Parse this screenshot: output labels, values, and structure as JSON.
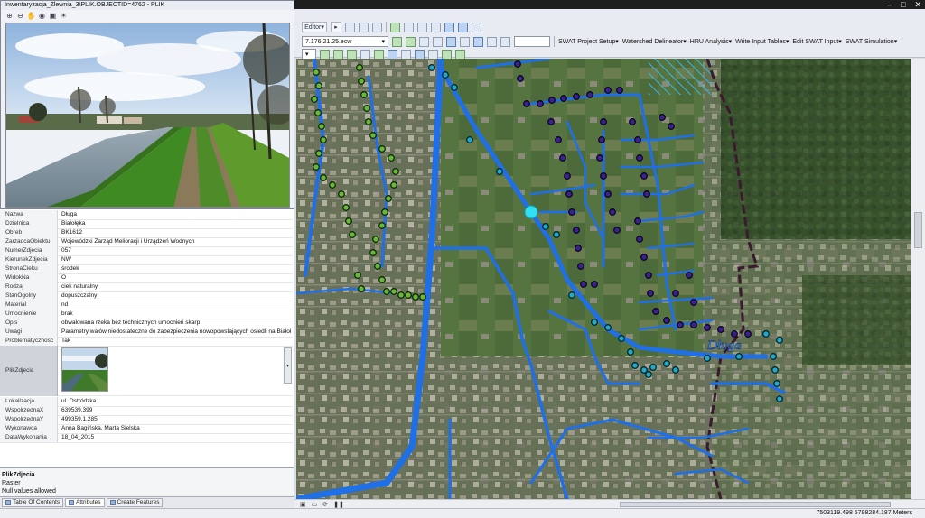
{
  "photo_window": {
    "title": "Inwentaryzacja_Zlewnia_3\\PLIK.OBJECTID=4762 - PLIK",
    "tools": [
      "zoom-in-icon",
      "zoom-out-icon",
      "pan-icon",
      "full-extent-icon",
      "open-icon",
      "light-icon"
    ]
  },
  "toolbar": {
    "editor_label": "Editor",
    "scale_combo": "7.176.21.25.ecw",
    "menus": [
      "SWAT Project Setup",
      "Watershed Delineator",
      "HRU Analysis",
      "Write Input Tables",
      "Edit SWAT Input",
      "SWAT Simulation"
    ]
  },
  "attributes": [
    {
      "key": "Nazwa",
      "value": "Długa"
    },
    {
      "key": "Dzielnica",
      "value": "Białołęka"
    },
    {
      "key": "Obreb",
      "value": "BK1612"
    },
    {
      "key": "ZarzadcaObiektu",
      "value": "Wojewódzki Zarząd Melioracji i Urządzeń Wodnych"
    },
    {
      "key": "NumerZdjecia",
      "value": "057"
    },
    {
      "key": "KierunekZdjecia",
      "value": "NW"
    },
    {
      "key": "StronaCieku",
      "value": "środek"
    },
    {
      "key": "WidokNa",
      "value": "O"
    },
    {
      "key": "Rodzaj",
      "value": "ciek naturalny"
    },
    {
      "key": "StanOgolny",
      "value": "dopuszczalny"
    },
    {
      "key": "Material",
      "value": "nd"
    },
    {
      "key": "Umocnienie",
      "value": "brak"
    },
    {
      "key": "Opis",
      "value": "obwałowana rzeka bez technicznych umocnień skarp"
    },
    {
      "key": "Uwagi",
      "value": "Parametry wałów niedostateczne do zabezpieczenia nowopowstających osiedli na Białołęce"
    },
    {
      "key": "Problematycznosc",
      "value": "Tak"
    }
  ],
  "photo_field": {
    "key": "PlikZdjecia"
  },
  "attributes_after": [
    {
      "key": "Lokalizacja",
      "value": "ul. Ostródzka"
    },
    {
      "key": "WspolrzednaX",
      "value": "639539.399"
    },
    {
      "key": "WspolrzednaY",
      "value": "499359.1.285"
    },
    {
      "key": "Wykonawca",
      "value": "Anna Bagińska, Marta Sielska"
    },
    {
      "key": "DataWykonania",
      "value": "18_04_2015"
    }
  ],
  "description": {
    "title": "PlikZdjecia",
    "line1": "Raster",
    "line2": "Null values allowed"
  },
  "tabs": [
    "Table Of Contents",
    "Attributes",
    "Create Features"
  ],
  "map": {
    "river_label": "Długa",
    "colors": {
      "river": "#1f6fe6",
      "point_green": "#6ab83a",
      "point_purple": "#3b2090",
      "point_cyan": "#22a8c8",
      "selected": "#33e0f0",
      "boundary": "#3a1a2e"
    }
  },
  "status": {
    "coordinates": "7503119.498  5798284.187 Meters"
  }
}
